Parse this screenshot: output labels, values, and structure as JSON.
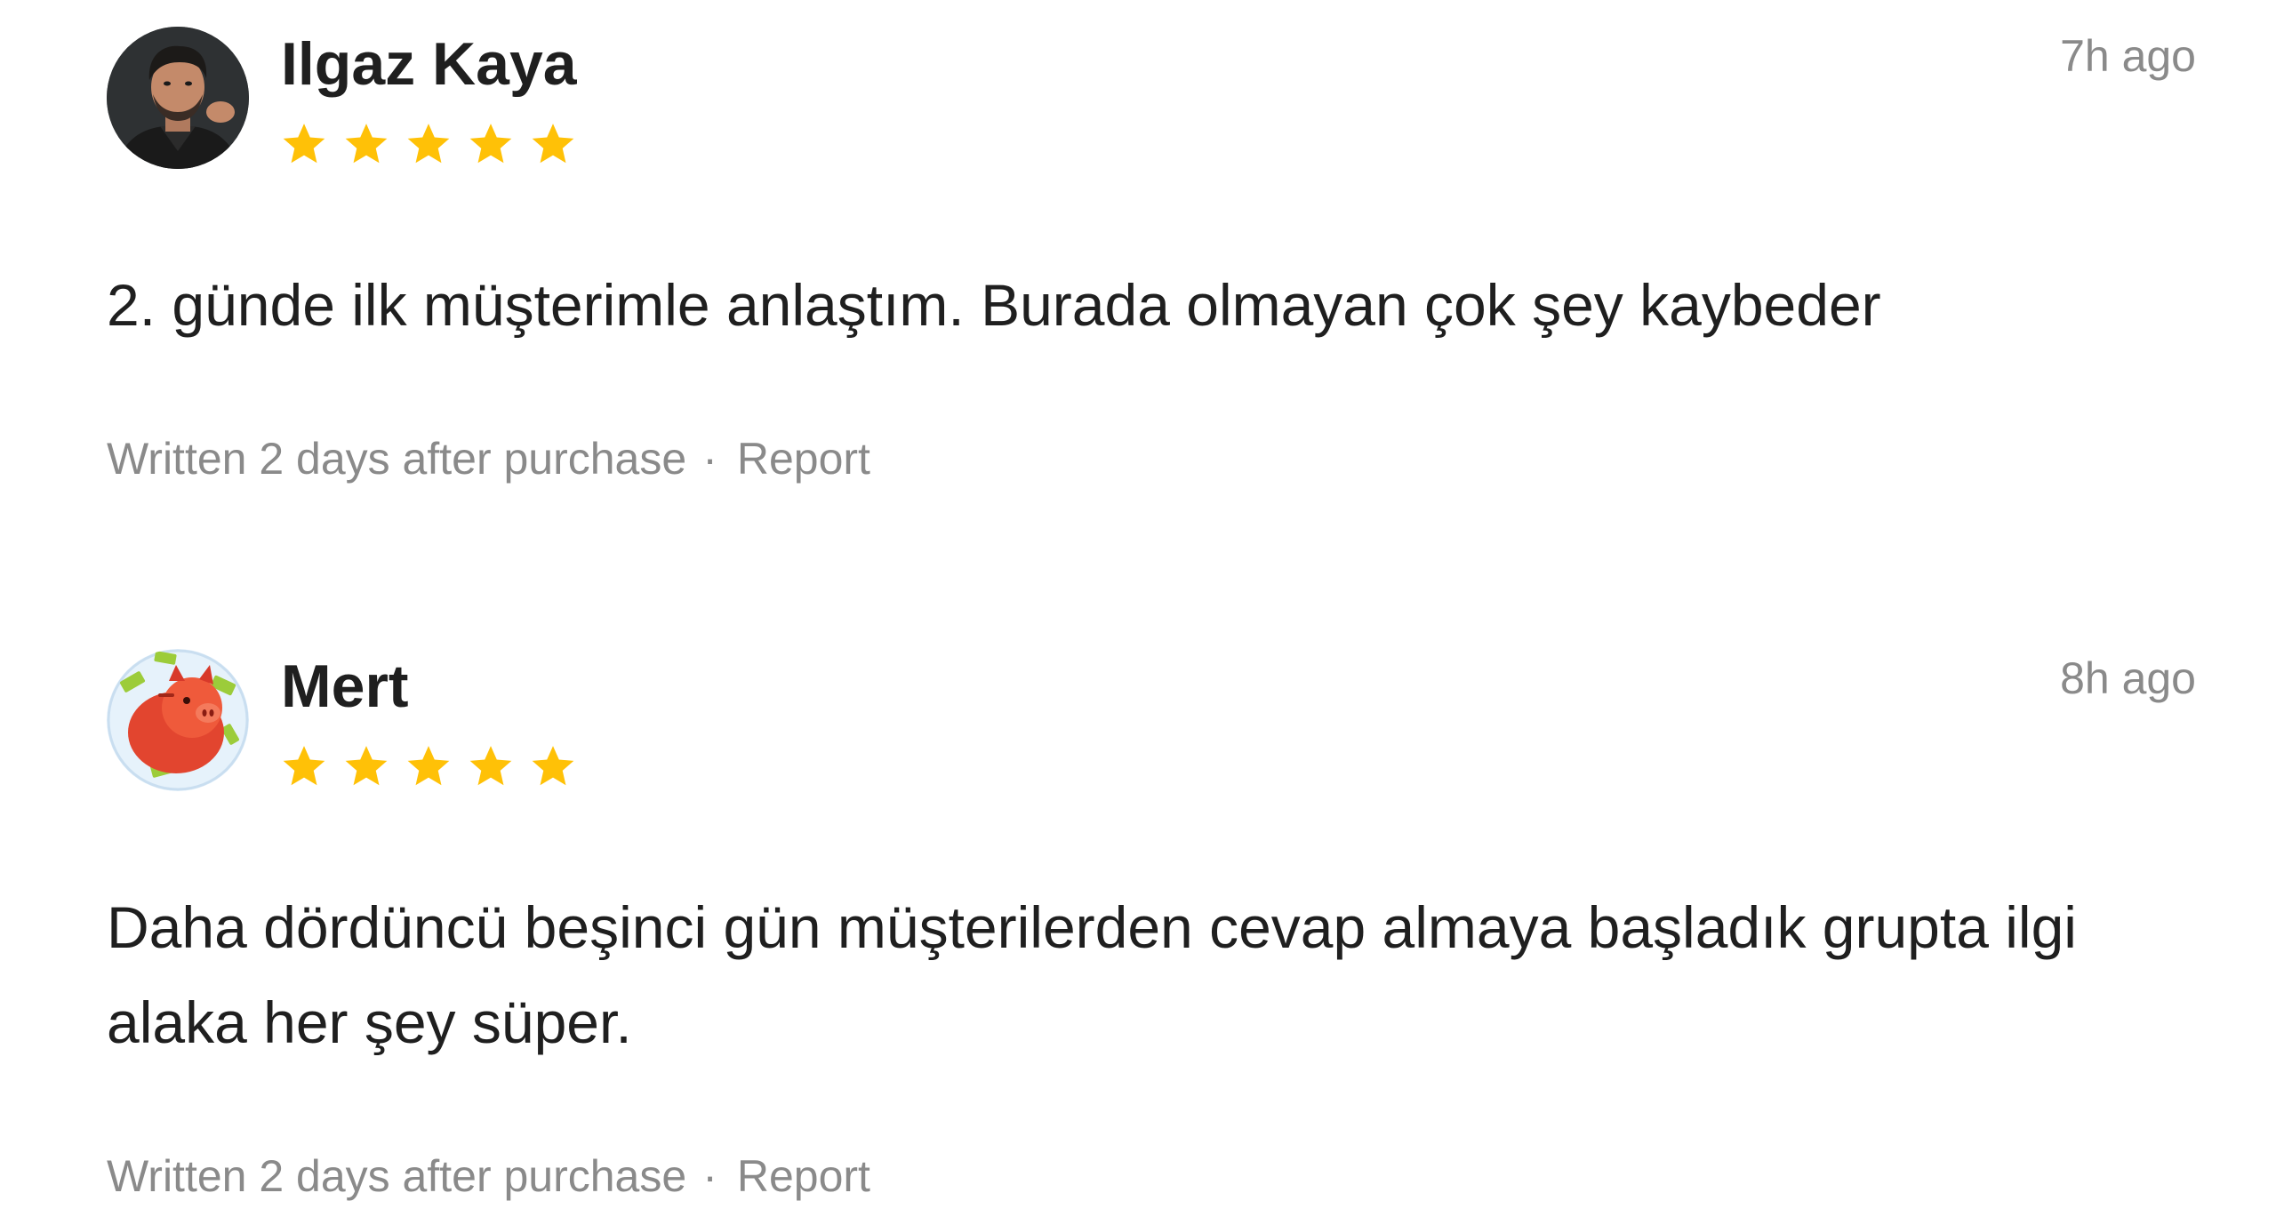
{
  "reviews": [
    {
      "name": "Ilgaz Kaya",
      "time": "7h ago",
      "rating": 5,
      "text": "2. günde ilk müşterimle anlaştım. Burada olmayan çok şey kaybeder",
      "written": "Written 2 days after purchase",
      "separator": "·",
      "report": "Report",
      "avatar": "man-portrait-photo"
    },
    {
      "name": "Mert",
      "time": "8h ago",
      "rating": 5,
      "text": "Daha dördüncü beşinci gün müşterilerden cevap almaya başladık grupta ilgi alaka her şey süper.",
      "written": "Written 2 days after purchase",
      "separator": "·",
      "report": "Report",
      "avatar": "piggy-bank-money-icon"
    }
  ],
  "colors": {
    "star": "#FFC107",
    "muted": "#8a8a8a",
    "text": "#1f1f1f"
  }
}
